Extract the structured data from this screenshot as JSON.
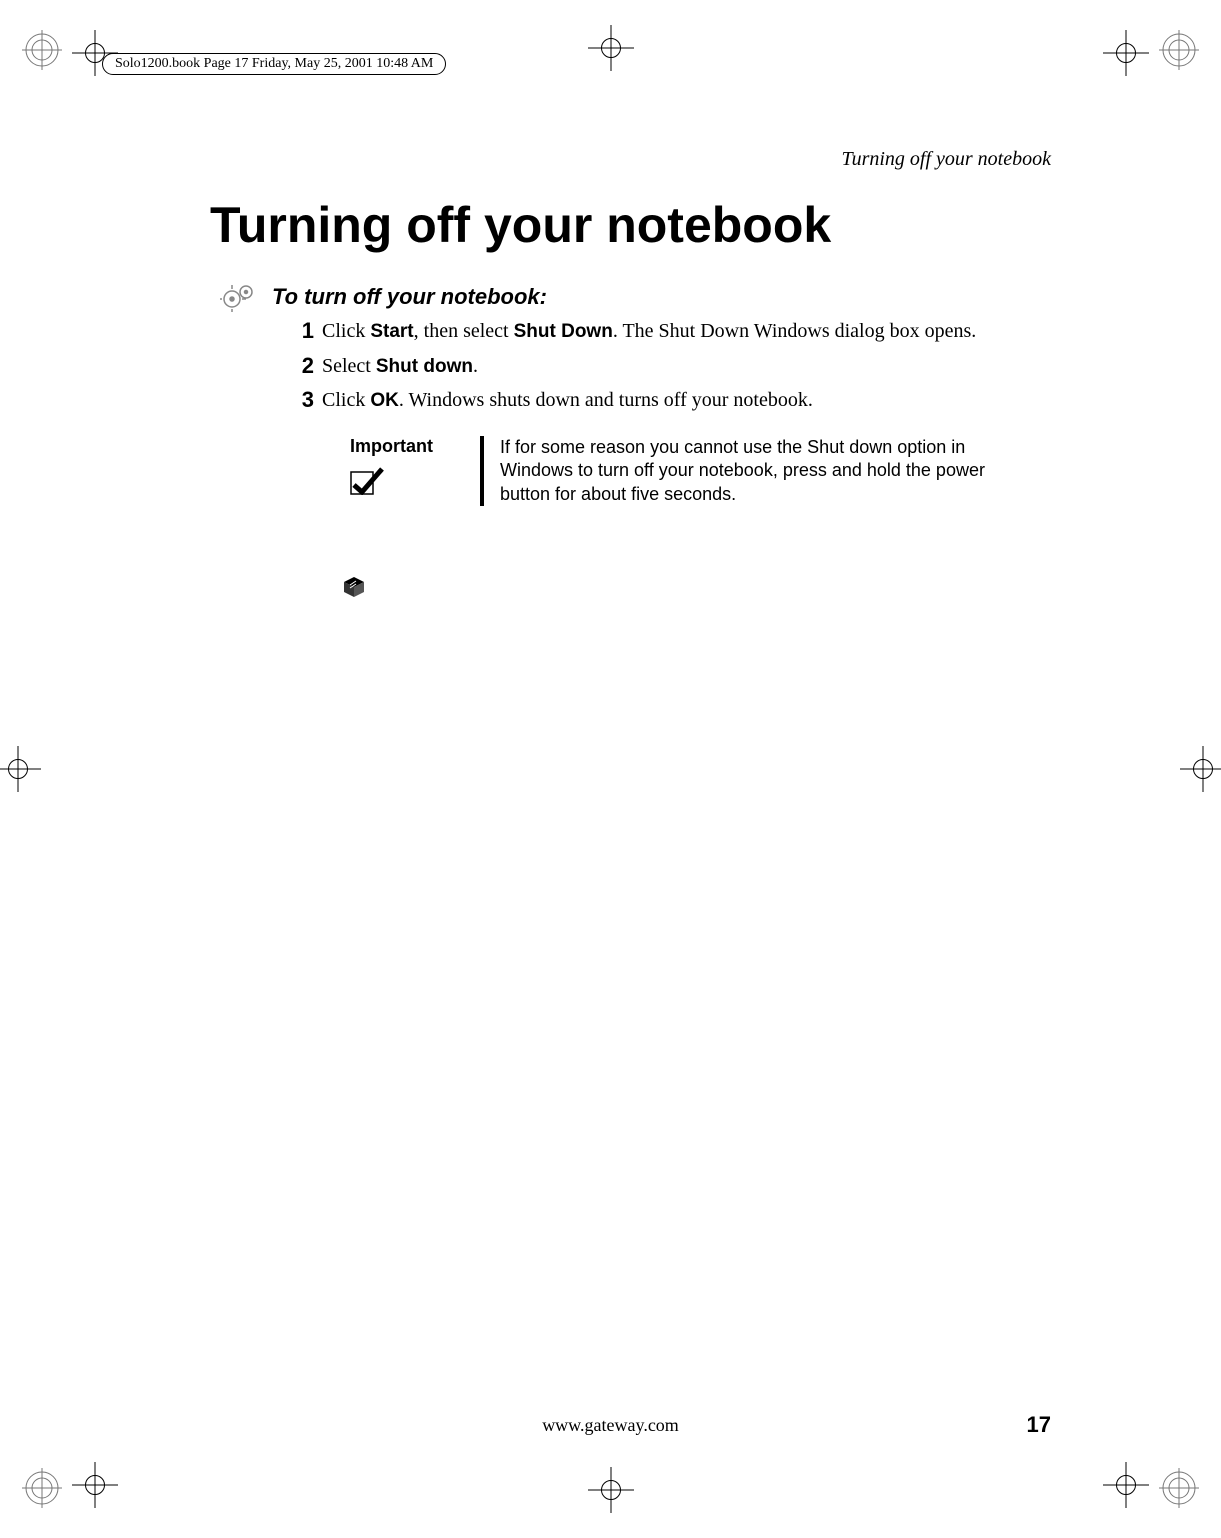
{
  "print_header": "Solo1200.book  Page 17  Friday, May 25, 2001  10:48 AM",
  "running_head": "Turning off your notebook",
  "title": "Turning off your notebook",
  "steps_heading": "To turn off your notebook:",
  "steps": [
    {
      "num": "1",
      "pre": "Click ",
      "bold1": "Start",
      "mid": ", then select ",
      "bold2": "Shut Down",
      "post": ". The Shut Down Windows dialog box opens."
    },
    {
      "num": "2",
      "pre": "Select ",
      "bold1": "Shut down",
      "mid": "",
      "bold2": "",
      "post": "."
    },
    {
      "num": "3",
      "pre": "Click ",
      "bold1": "OK",
      "mid": "",
      "bold2": "",
      "post": ". Windows shuts down and turns off your notebook."
    }
  ],
  "important_label": "Important",
  "important_text": "If for some reason you cannot use the Shut down option in Windows to turn off your notebook, press and hold the power button for about five seconds.",
  "footer_url": "www.gateway.com",
  "page_number": "17"
}
